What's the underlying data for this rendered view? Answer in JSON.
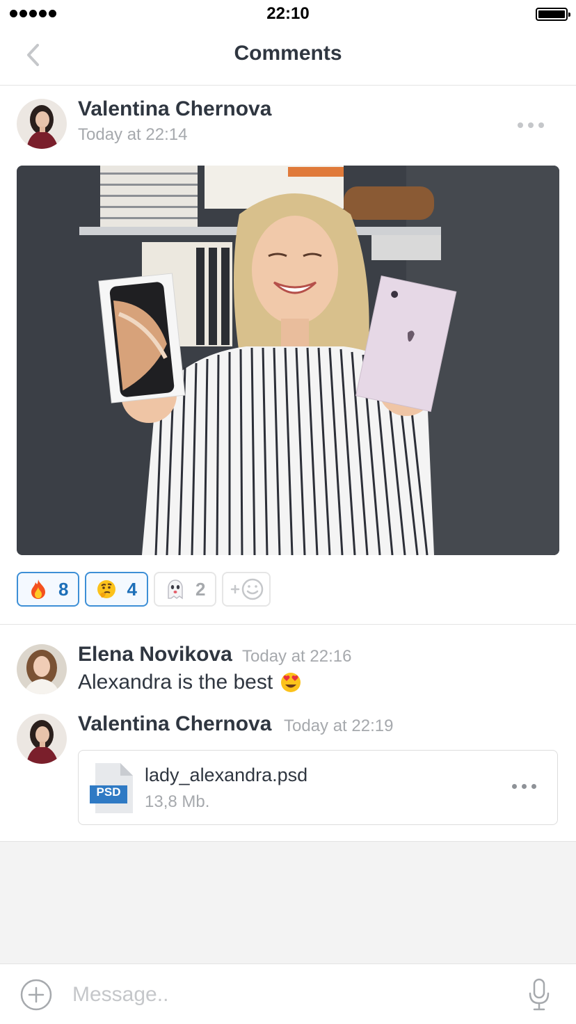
{
  "status_bar": {
    "time": "22:10"
  },
  "header": {
    "title": "Comments"
  },
  "post": {
    "author": "Valentina Chernova",
    "time": "Today at 22:14",
    "reactions": [
      {
        "emoji": "fire-emoji",
        "count": "8",
        "active": true
      },
      {
        "emoji": "thinking-face-emoji",
        "count": "4",
        "active": true
      },
      {
        "emoji": "ghost-emoji",
        "count": "2",
        "active": false
      }
    ]
  },
  "comments": [
    {
      "author": "Elena Novikova",
      "time": "Today at 22:16",
      "text": "Alexandra is the best",
      "emoji": "heart-eyes-emoji"
    },
    {
      "author": "Valentina Chernova",
      "time": "Today at 22:19",
      "file": {
        "type": "PSD",
        "name": "lady_alexandra.psd",
        "size": "13,8 Mb."
      }
    }
  ],
  "composer": {
    "placeholder": "Message.."
  },
  "colors": {
    "accent": "#3d8fd6",
    "text": "#2f3640",
    "muted": "#a6a9ad",
    "file_badge": "#2f7ac4"
  }
}
